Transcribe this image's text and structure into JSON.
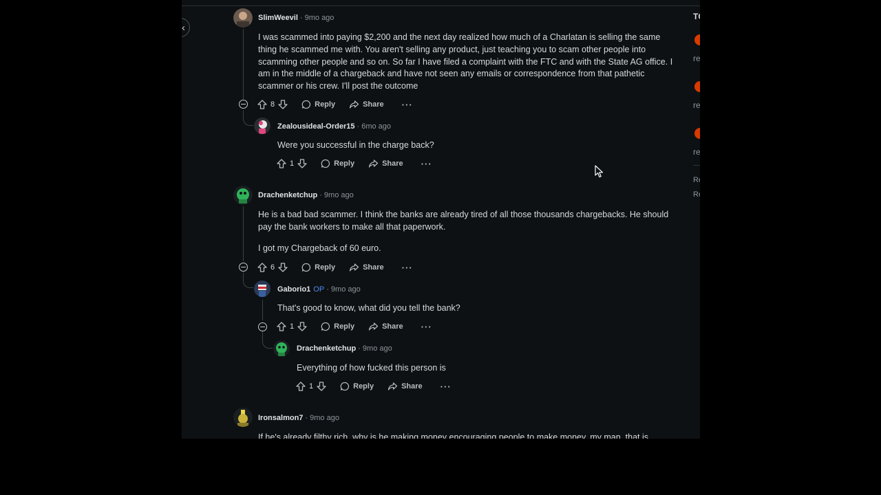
{
  "nav": {
    "back_glyph": "‹"
  },
  "sidebar": {
    "header": "TC",
    "items": [
      "re",
      "re",
      "re"
    ],
    "links": [
      "Re",
      "Re"
    ]
  },
  "comments": [
    {
      "author": "SlimWeevil",
      "op": "",
      "time": "· 9mo ago",
      "text": "I was scammed into paying $2,200 and the next day realized how much of a Charlatan is selling the same thing he scammed me with. You aren't selling any product, just teaching you to scam other people into scamming other people and so on. So far I have filed a complaint with the FTC and with the State AG office. I am in the middle of a chargeback and have not seen any emails or correspondence from that pathetic scammer or his crew. I'll post the outcome",
      "votes": "8",
      "reply": "Reply",
      "share": "Share",
      "more": "···"
    },
    {
      "author": "Zealousideal-Order15",
      "op": "",
      "time": "· 6mo ago",
      "text": "Were you successful in the charge back?",
      "votes": "1",
      "reply": "Reply",
      "share": "Share",
      "more": "···"
    },
    {
      "author": "Drachenketchup",
      "op": "",
      "time": "· 9mo ago",
      "text": "He is a bad bad scammer. I think the banks are already tired of all those thousands chargebacks. He should pay the bank workers to make all that paperwork.",
      "text2": "I got my Chargeback of 60 euro.",
      "votes": "6",
      "reply": "Reply",
      "share": "Share",
      "more": "···"
    },
    {
      "author": "Gaborio1",
      "op": "OP",
      "time": "· 9mo ago",
      "text": "That's good to know, what did you tell the bank?",
      "votes": "1",
      "reply": "Reply",
      "share": "Share",
      "more": "···"
    },
    {
      "author": "Drachenketchup",
      "op": "",
      "time": "· 9mo ago",
      "text": "Everything of how fucked this person is",
      "votes": "1",
      "reply": "Reply",
      "share": "Share",
      "more": "···"
    },
    {
      "author": "Ironsalmon7",
      "op": "",
      "time": "· 9mo ago",
      "text": "If he's already filthy rich, why is he making money encouraging people to make money, my man, that is"
    }
  ],
  "colors": {
    "background": "#0e1113",
    "op_badge": "#4c8bf5",
    "sidebar_icon": "#d93a00"
  },
  "icons": [
    "back-arrow-icon",
    "upvote-icon",
    "downvote-icon",
    "reply-bubble-icon",
    "share-icon",
    "more-icon",
    "collapse-icon",
    "mouse-cursor-icon"
  ]
}
